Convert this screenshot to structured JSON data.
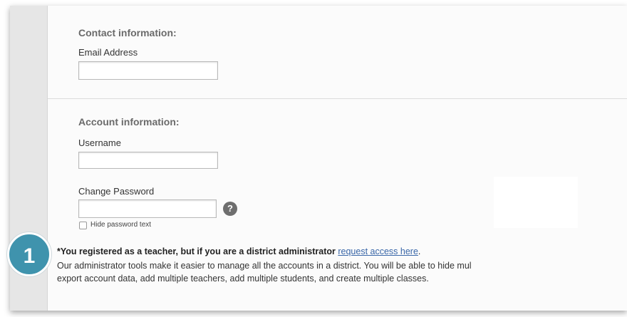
{
  "contact": {
    "title": "Contact information:",
    "email_label": "Email Address",
    "email_value": ""
  },
  "account": {
    "title": "Account information:",
    "username_label": "Username",
    "username_value": "",
    "password_label": "Change Password",
    "password_value": "",
    "help_icon_glyph": "?",
    "hide_password_label": "Hide password text"
  },
  "notice": {
    "step_number": "1",
    "bold_text": "*You registered as a teacher, but if you are a district administrator",
    "link_text": "request access here",
    "link_suffix": ".",
    "line2": "Our administrator tools make it easier to manage all the accounts in a district. You will be able to hide mul",
    "line3": "export account data, add multiple teachers, add multiple students, and create multiple classes."
  },
  "colors": {
    "badge": "#3f93ad",
    "link": "#3a67a8",
    "section_title": "#6a6a6a"
  }
}
